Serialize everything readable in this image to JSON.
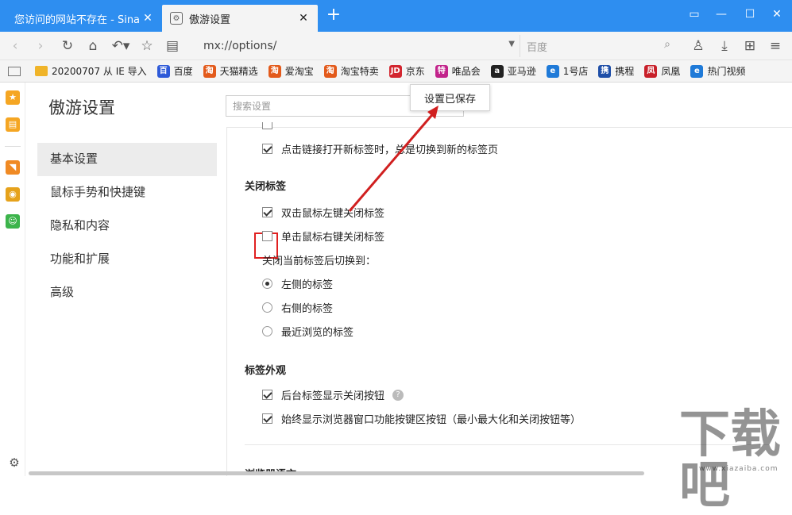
{
  "tabs": [
    {
      "label": "您访问的网站不存在 - Sina A",
      "active": false
    },
    {
      "label": "傲游设置",
      "active": true
    }
  ],
  "navbar": {
    "address": "mx://options/",
    "search_placeholder": "百度"
  },
  "bookmarks": [
    {
      "label": "20200707 从 IE 导入",
      "icon": "folder-icon",
      "color": "#f0b429",
      "glyph": ""
    },
    {
      "label": "百度",
      "icon": "baidu-icon",
      "color": "#2e5ad8",
      "glyph": "百"
    },
    {
      "label": "天猫精选",
      "icon": "taobao-icon",
      "color": "#e35a1b",
      "glyph": "淘"
    },
    {
      "label": "爱淘宝",
      "icon": "taobao-icon",
      "color": "#e35a1b",
      "glyph": "淘"
    },
    {
      "label": "淘宝特卖",
      "icon": "taobao-icon",
      "color": "#e35a1b",
      "glyph": "淘"
    },
    {
      "label": "京东",
      "icon": "jd-icon",
      "color": "#d3262f",
      "glyph": "JD"
    },
    {
      "label": "唯品会",
      "icon": "vip-icon",
      "color": "#c2248b",
      "glyph": "特"
    },
    {
      "label": "亚马逊",
      "icon": "amazon-icon",
      "color": "#222222",
      "glyph": "a"
    },
    {
      "label": "1号店",
      "icon": "ie-icon",
      "color": "#1f7ad8",
      "glyph": "e"
    },
    {
      "label": "携程",
      "icon": "ctrip-icon",
      "color": "#1f4fa8",
      "glyph": "携"
    },
    {
      "label": "凤凰",
      "icon": "phoenix-icon",
      "color": "#c8202a",
      "glyph": "凤"
    },
    {
      "label": "热门视频",
      "icon": "ie-icon",
      "color": "#1f7ad8",
      "glyph": "e"
    }
  ],
  "page": {
    "title": "傲游设置",
    "search_placeholder": "搜索设置",
    "toast": "设置已保存"
  },
  "menu": [
    {
      "label": "基本设置",
      "selected": true
    },
    {
      "label": "鼠标手势和快捷键",
      "selected": false
    },
    {
      "label": "隐私和内容",
      "selected": false
    },
    {
      "label": "功能和扩展",
      "selected": false
    },
    {
      "label": "高级",
      "selected": false
    }
  ],
  "settings": {
    "open_new_tab": {
      "label": "点击链接打开新标签时，总是切换到新的标签页",
      "checked": true
    },
    "close_tab_heading": "关闭标签",
    "double_click_close": {
      "label": "双击鼠标左键关闭标签",
      "checked": true
    },
    "right_click_close": {
      "label": "单击鼠标右键关闭标签",
      "checked": false
    },
    "after_close_label": "关闭当前标签后切换到：",
    "after_close_options": [
      {
        "label": "左侧的标签",
        "selected": true
      },
      {
        "label": "右侧的标签",
        "selected": false
      },
      {
        "label": "最近浏览的标签",
        "selected": false
      }
    ],
    "tab_appearance_heading": "标签外观",
    "bg_tab_close_btn": {
      "label": "后台标签显示关闭按钮",
      "checked": true
    },
    "always_show_window_btns": {
      "label": "始终显示浏览器窗口功能按键区按钮（最小最大化和关闭按钮等）",
      "checked": true
    },
    "browser_language_heading": "浏览器语言"
  },
  "watermark": {
    "text": "下载吧",
    "small": "www.xiazaiba.com"
  }
}
